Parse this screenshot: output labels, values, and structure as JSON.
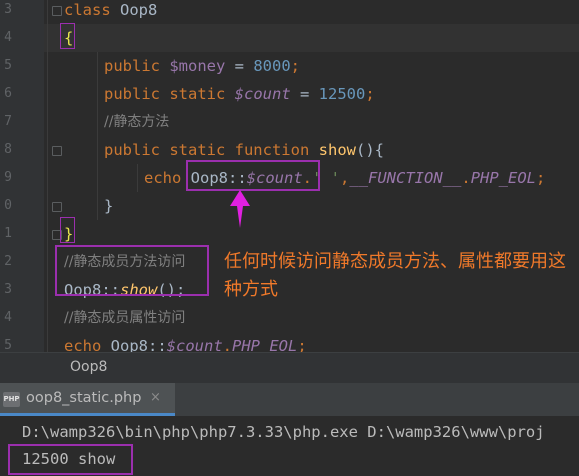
{
  "editor": {
    "line_numbers": [
      "3",
      "4",
      "5",
      "6",
      "7",
      "8",
      "9",
      "0",
      "1",
      "2",
      "3",
      "4",
      "5"
    ],
    "code": {
      "class_kw": "class",
      "class_name": "Oop8",
      "open_brace": "{",
      "l3_kw": "public",
      "l3_var": "$money",
      "l3_eq": " = ",
      "l3_num": "8000",
      "l3_semi": ";",
      "l4_kw": "public static",
      "l4_var": "$count",
      "l4_eq": " = ",
      "l4_num": "12500",
      "l4_semi": ";",
      "l5_comment": "//静态方法",
      "l6_kw": "public static function",
      "l6_fn": "show",
      "l6_rest": "(){",
      "l7_kw": "echo",
      "l7_class": "Oop8::",
      "l7_var": "$count",
      "l7_dot": ".",
      "l7_str": "' '",
      "l7_comma": ",",
      "l7_const": "__FUNCTION__",
      "l7_dot2": ".",
      "l7_const2": "PHP_EOL",
      "l7_semi": ";",
      "l8_brace": "}",
      "close_brace": "}",
      "c1": "//静态成员方法访问",
      "call_class": "Oop8::",
      "call_fn": "show",
      "call_rest": "();",
      "c2": "//静态成员属性访问",
      "last_kw": "echo",
      "last_class": " Oop8::",
      "last_var": "$count",
      "last_dot": ".",
      "last_const": "PHP_EOL",
      "last_semi": ";"
    },
    "annotation": "任何时候访问静态成员方法、属性都要用这种方式"
  },
  "breadcrumb": {
    "label": "Oop8"
  },
  "run_tab": {
    "icon": "php-file-icon",
    "icon_text": "PHP",
    "title": "oop8_static.php",
    "close": "×"
  },
  "console": {
    "command": "D:\\wamp326\\bin\\php\\php7.3.33\\php.exe D:\\wamp326\\www\\proj",
    "output": "12500 show"
  },
  "colors": {
    "highlight_box": "#9b2fae",
    "arrow": "#e020e0",
    "annotation": "#f0792a"
  }
}
